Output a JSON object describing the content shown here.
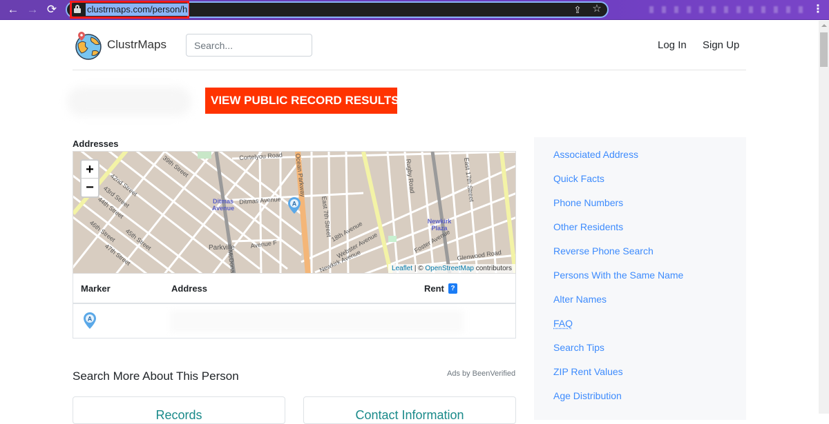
{
  "browser": {
    "url": "clustrmaps.com/person/h",
    "back_icon": "arrow-left-icon",
    "forward_icon": "arrow-right-icon",
    "reload_icon": "reload-icon",
    "share_icon": "share-icon",
    "bookmark_icon": "star-icon",
    "menu_icon": "kebab-menu-icon",
    "glyphs": {
      "back": "←",
      "forward": "→",
      "reload": "⟳",
      "share": "⇪",
      "star": "☆",
      "menu": "⋮"
    }
  },
  "header": {
    "brand": "ClustrMaps",
    "search_placeholder": "Search...",
    "search_value": "",
    "login": "Log In",
    "signup": "Sign Up"
  },
  "cta": {
    "label": "VIEW PUBLIC RECORD RESULTS✓",
    "color": "#ff3300"
  },
  "addresses": {
    "title": "Addresses",
    "map": {
      "zoom_in": "+",
      "zoom_out": "−",
      "attribution_leaflet": "Leaflet",
      "attribution_sep": " | © ",
      "attribution_osm": "OpenStreetMap",
      "attribution_tail": " contributors",
      "stations": [
        "Ditmas Avenue",
        "Newkirk Plaza"
      ],
      "street_labels": [
        "42nd Street",
        "43rd Street",
        "44th Street",
        "45th Street",
        "46th Street",
        "47th Street",
        "39th Street",
        "Ditmas Avenue",
        "Cortelyou Road",
        "Ocean Parkway",
        "East 7th Street",
        "18th Avenue",
        "Webster Avenue",
        "Avenue F",
        "Parkville",
        "Rugby Road",
        "East 17th Street",
        "Foster Avenue",
        "Glenwood Road",
        "Newkirk Avenue",
        "McDonald"
      ],
      "marker_letter": "A"
    },
    "table": {
      "columns": [
        "Marker",
        "Address",
        "Rent"
      ],
      "rent_help": "?",
      "rows": [
        {
          "marker": "A",
          "address": "",
          "rent": ""
        }
      ]
    }
  },
  "search_more": {
    "title": "Search More About This Person",
    "ads_label": "Ads by BeenVerified",
    "cards": [
      {
        "title": "Records"
      },
      {
        "title": "Contact Information"
      }
    ]
  },
  "sidebar": {
    "items": [
      {
        "label": "Associated Address"
      },
      {
        "label": "Quick Facts"
      },
      {
        "label": "Phone Numbers"
      },
      {
        "label": "Other Residents"
      },
      {
        "label": "Reverse Phone Search"
      },
      {
        "label": "Persons With the Same Name"
      },
      {
        "label": "Alter Names"
      },
      {
        "label": "FAQ"
      },
      {
        "label": "Search Tips"
      },
      {
        "label": "ZIP Rent Values"
      },
      {
        "label": "Age Distribution"
      }
    ]
  },
  "colors": {
    "link": "#3d8bfd",
    "cta": "#ff3300",
    "marker": "#5aa8e8",
    "browser_frame": "#6b3cbf"
  }
}
